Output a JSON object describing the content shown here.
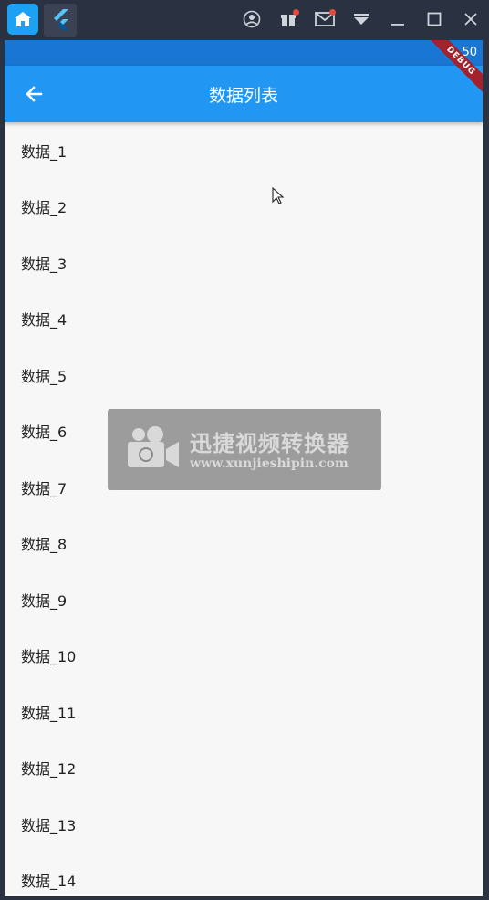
{
  "statusbar": {
    "time": "50"
  },
  "appbar": {
    "title": "数据列表",
    "debug_label": "DEBUG"
  },
  "list": {
    "items": [
      "数据_1",
      "数据_2",
      "数据_3",
      "数据_4",
      "数据_5",
      "数据_6",
      "数据_7",
      "数据_8",
      "数据_9",
      "数据_10",
      "数据_11",
      "数据_12",
      "数据_13",
      "数据_14"
    ]
  },
  "watermark": {
    "title": "迅捷视频转换器",
    "url": "www.xunjieshipin.com"
  },
  "colors": {
    "appbar": "#2196f3",
    "statusbar": "#1976d2",
    "background": "#f7f7f7"
  }
}
